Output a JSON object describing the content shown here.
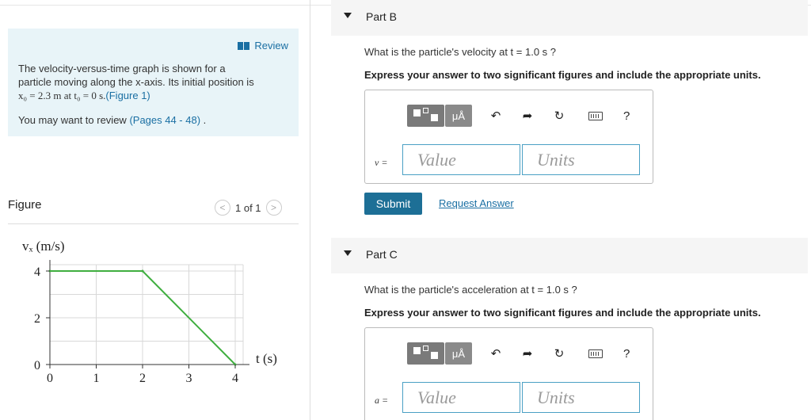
{
  "intro": {
    "review_label": "Review",
    "line1": "The velocity-versus-time graph is shown for a",
    "line2": "particle moving along the x-axis. Its initial position is",
    "line3_prefix": "x₀ = 2.3 m at t₀ = 0 s.",
    "figure_link": "(Figure 1)",
    "review_text_prefix": "You may want to review ",
    "pages_link": "(Pages 44 - 48)",
    "review_text_suffix": " ."
  },
  "figure": {
    "title": "Figure",
    "pager_text": "1 of 1",
    "prev_glyph": "<",
    "next_glyph": ">"
  },
  "chart_data": {
    "type": "line",
    "title": "",
    "ylabel": "vₓ (m/s)",
    "xlabel": "t (s)",
    "x_ticks": [
      "0",
      "1",
      "2",
      "3",
      "4"
    ],
    "y_ticks": [
      "0",
      "2",
      "4"
    ],
    "xlim": [
      0,
      4
    ],
    "ylim": [
      0,
      4
    ],
    "grid": true,
    "series": [
      {
        "x": [
          0,
          2,
          4
        ],
        "y": [
          4,
          4,
          0
        ],
        "color": "#3fae3f"
      }
    ]
  },
  "partB": {
    "label": "Part B",
    "question": "What is the particle's velocity at t = 1.0 s ?",
    "instruction": "Express your answer to two significant figures and include the appropriate units.",
    "var_label": "v =",
    "value_placeholder": "Value",
    "units_placeholder": "Units",
    "submit_label": "Submit",
    "request_label": "Request Answer"
  },
  "partC": {
    "label": "Part C",
    "question": "What is the particle's acceleration at t = 1.0 s ?",
    "instruction": "Express your answer to two significant figures and include the appropriate units.",
    "var_label": "a =",
    "value_placeholder": "Value",
    "units_placeholder": "Units"
  },
  "toolbar": {
    "mu_label": "μÅ",
    "undo_icon": "↶",
    "redo_icon": "➦",
    "reset_icon": "↻",
    "help_label": "?"
  }
}
